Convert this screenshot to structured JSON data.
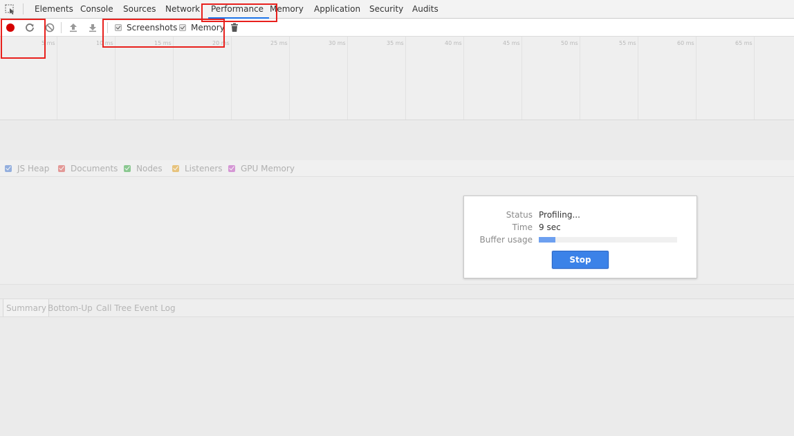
{
  "tabs": [
    {
      "label": "Elements"
    },
    {
      "label": "Console"
    },
    {
      "label": "Sources"
    },
    {
      "label": "Network"
    },
    {
      "label": "Performance",
      "active": true
    },
    {
      "label": "Memory"
    },
    {
      "label": "Application"
    },
    {
      "label": "Security"
    },
    {
      "label": "Audits"
    }
  ],
  "toolbar": {
    "record_icon": "record-icon",
    "reload_icon": "reload-icon",
    "clear_icon": "clear-icon",
    "load_icon": "upload-icon",
    "save_icon": "download-icon",
    "screenshots_label": "Screenshots",
    "screenshots_checked": true,
    "memory_label": "Memory",
    "memory_checked": true,
    "garbage_icon": "trash-icon"
  },
  "timeline": {
    "ticks": [
      "5 ms",
      "10 ms",
      "15 ms",
      "20 ms",
      "25 ms",
      "30 ms",
      "35 ms",
      "40 ms",
      "45 ms",
      "50 ms",
      "55 ms",
      "60 ms",
      "65 ms"
    ]
  },
  "counters": [
    {
      "label": "JS Heap",
      "color": "#4a7bd0"
    },
    {
      "label": "Documents",
      "color": "#d9534f"
    },
    {
      "label": "Nodes",
      "color": "#39a845"
    },
    {
      "label": "Listeners",
      "color": "#e0a020"
    },
    {
      "label": "GPU Memory",
      "color": "#c04fc0"
    }
  ],
  "bottom_tabs": [
    {
      "label": "Summary"
    },
    {
      "label": "Bottom-Up"
    },
    {
      "label": "Call Tree"
    },
    {
      "label": "Event Log"
    }
  ],
  "dialog": {
    "status_label": "Status",
    "status_value": "Profiling...",
    "time_label": "Time",
    "time_value": "9 sec",
    "buffer_label": "Buffer usage",
    "buffer_fraction": 0.12,
    "stop_label": "Stop"
  },
  "colors": {
    "accent": "#1a73e8",
    "record": "#d50000",
    "stop_button": "#3b82e8",
    "buffer_fill": "#6da0f0",
    "highlight": "#e8201c"
  }
}
